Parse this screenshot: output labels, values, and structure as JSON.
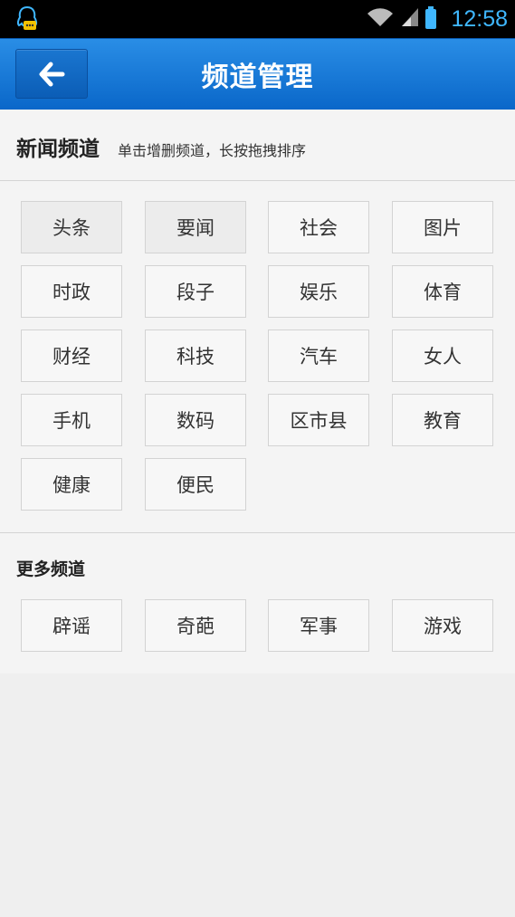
{
  "status_bar": {
    "time": "12:58",
    "icons": [
      "notification-qq-icon",
      "wifi-icon",
      "signal-icon",
      "battery-icon"
    ],
    "accent_color": "#3fb7ff"
  },
  "header": {
    "title": "频道管理",
    "back_icon": "arrow-left-icon",
    "color": "#1a7ad8"
  },
  "news_section": {
    "title": "新闻频道",
    "hint": "单击增删频道，长按拖拽排序",
    "channels": [
      {
        "label": "头条",
        "fixed": true
      },
      {
        "label": "要闻",
        "fixed": true
      },
      {
        "label": "社会",
        "fixed": false
      },
      {
        "label": "图片",
        "fixed": false
      },
      {
        "label": "时政",
        "fixed": false
      },
      {
        "label": "段子",
        "fixed": false
      },
      {
        "label": "娱乐",
        "fixed": false
      },
      {
        "label": "体育",
        "fixed": false
      },
      {
        "label": "财经",
        "fixed": false
      },
      {
        "label": "科技",
        "fixed": false
      },
      {
        "label": "汽车",
        "fixed": false
      },
      {
        "label": "女人",
        "fixed": false
      },
      {
        "label": "手机",
        "fixed": false
      },
      {
        "label": "数码",
        "fixed": false
      },
      {
        "label": "区市县",
        "fixed": false
      },
      {
        "label": "教育",
        "fixed": false
      },
      {
        "label": "健康",
        "fixed": false
      },
      {
        "label": "便民",
        "fixed": false
      }
    ]
  },
  "more_section": {
    "title": "更多频道",
    "channels": [
      {
        "label": "辟谣"
      },
      {
        "label": "奇葩"
      },
      {
        "label": "军事"
      },
      {
        "label": "游戏"
      }
    ]
  }
}
